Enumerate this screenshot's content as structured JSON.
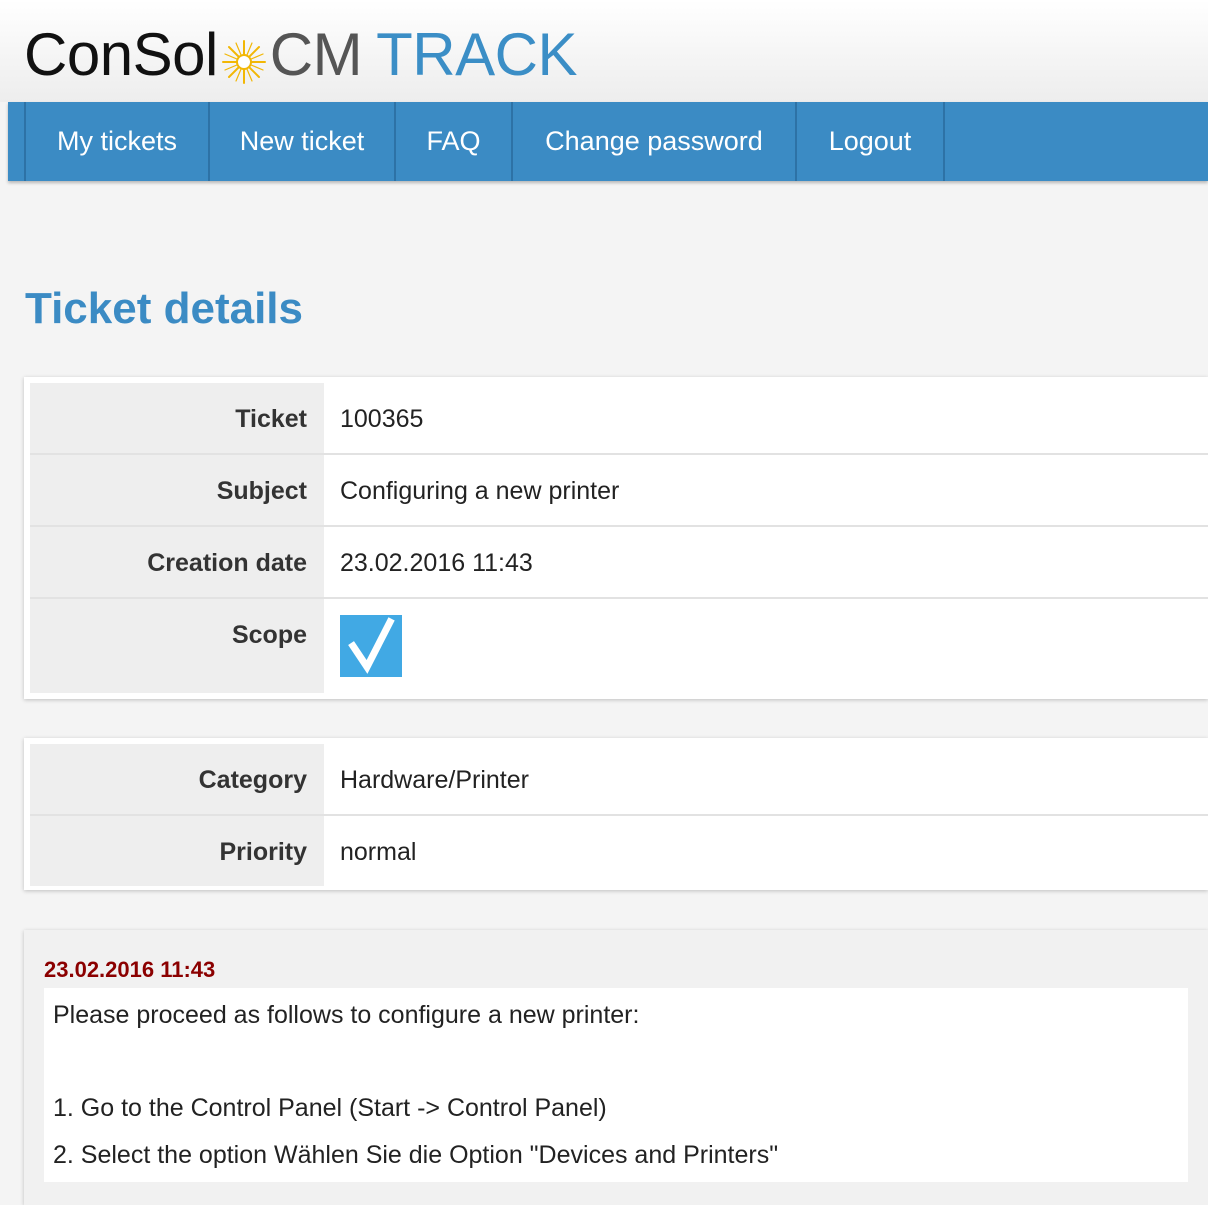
{
  "logo": {
    "brand": "ConSol",
    "product": "CM",
    "module": "TRACK"
  },
  "nav": {
    "items": [
      {
        "label": "My tickets"
      },
      {
        "label": "New ticket"
      },
      {
        "label": "FAQ"
      },
      {
        "label": "Change password"
      },
      {
        "label": "Logout"
      }
    ]
  },
  "page": {
    "title": "Ticket details"
  },
  "ticket_details": {
    "ticket_label": "Ticket",
    "ticket_value": "100365",
    "subject_label": "Subject",
    "subject_value": "Configuring a new printer",
    "creation_date_label": "Creation date",
    "creation_date_value": "23.02.2016 11:43",
    "scope_label": "Scope",
    "scope_checked": true
  },
  "classification": {
    "category_label": "Category",
    "category_value": "Hardware/Printer",
    "priority_label": "Priority",
    "priority_value": "normal"
  },
  "message": {
    "date": "23.02.2016 11:43",
    "lines": [
      "Please proceed as follows to configure a new printer:",
      "",
      "1. Go to the Control Panel (Start -> Control Panel)",
      "2. Select the option Wählen Sie die Option \"Devices and Printers\""
    ]
  },
  "colors": {
    "nav_background": "#3b8bc4",
    "accent_blue": "#3b8ec6",
    "checkbox_blue": "#41a9e4",
    "message_date": "#8b0000"
  },
  "icons": {
    "logo_sun": "sun-icon",
    "scope_check": "checkmark-icon"
  }
}
